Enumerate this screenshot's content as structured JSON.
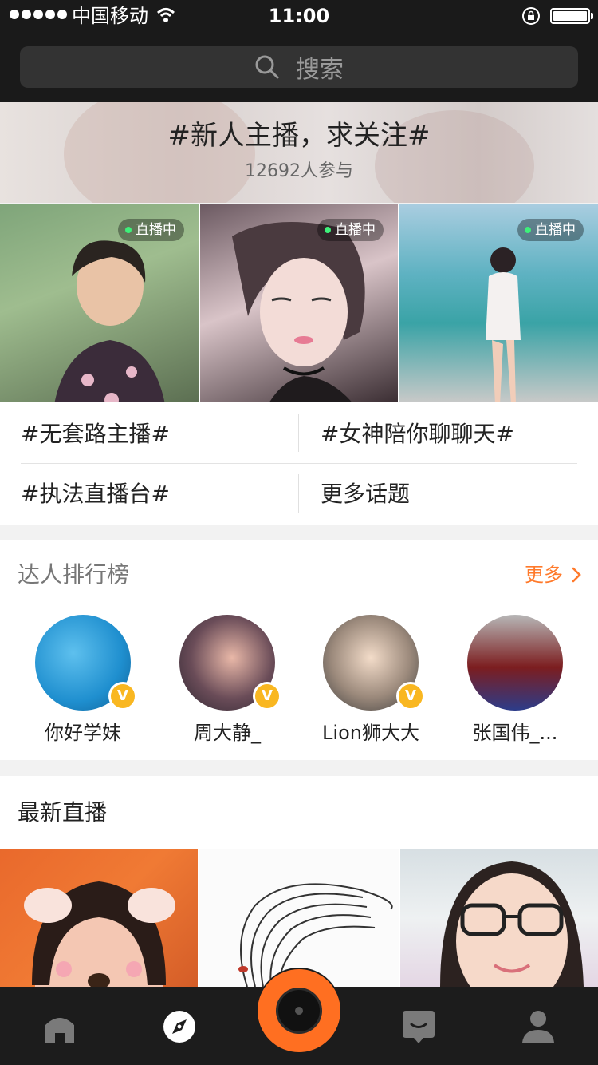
{
  "status_bar": {
    "carrier": "中国移动",
    "time": "11:00"
  },
  "search": {
    "placeholder": "搜索"
  },
  "featured_topic": {
    "title": "#新人主播，求关注#",
    "participants": "12692人参与"
  },
  "featured_live": [
    {
      "badge": "直播中"
    },
    {
      "badge": "直播中"
    },
    {
      "badge": "直播中"
    }
  ],
  "topics": [
    "#无套路主播#",
    "#女神陪你聊聊天#",
    "#执法直播台#",
    "更多话题"
  ],
  "ranking": {
    "title": "达人排行榜",
    "more_label": "更多",
    "users": [
      {
        "name": "你好学妹",
        "verified": true
      },
      {
        "name": "周大静_",
        "verified": true
      },
      {
        "name": "Lion狮大大",
        "verified": true
      },
      {
        "name": "张国伟_...",
        "verified": false
      }
    ]
  },
  "latest_live": {
    "title": "最新直播"
  },
  "tab_bar": {
    "tabs": [
      "home-icon",
      "compass-icon",
      "camera-icon",
      "messages-icon",
      "profile-icon"
    ],
    "active": "compass-icon"
  },
  "colors": {
    "accent": "#ff7a2b",
    "live_dot": "#3df07a",
    "verified_badge": "#f9b721",
    "bar_background": "#1a1a1a"
  }
}
